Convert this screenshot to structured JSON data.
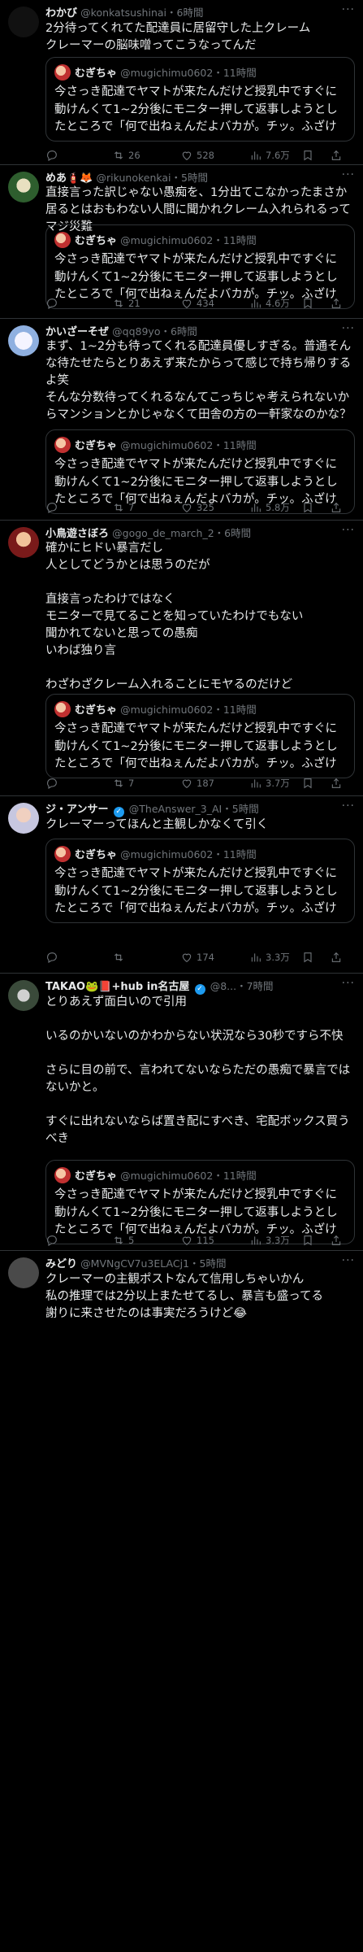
{
  "quote": {
    "name": "むぎちゃ",
    "handle": "@mugichimu0602",
    "time": "・11時間",
    "text": "今さっき配達でヤマトが来たんだけど授乳中ですぐに動けんくて1~2分後にモニター押して返事しようとしたところで「何で出ねぇんだよバカが。チッ。ふざけんなよ死ね。」って暴言吐かれてそっ閉じ。..."
  },
  "posts": [
    {
      "name": "わかび",
      "handle": "@konkatsushinai",
      "time": "・6時間",
      "text": "2分待ってくれてた配達員に居留守した上クレーム\nクレーマーの脳味噌ってこうなってんだ",
      "replies": "",
      "retweets": "26",
      "likes": "528",
      "views": "7.6万"
    },
    {
      "name": "めあ🧯🦊",
      "handle": "@rikunokenkai",
      "time": "・5時間",
      "text": "直接言った訳じゃない愚痴を、1分出てこなかったまさか居るとはおもわない人間に聞かれクレーム入れられるってマジ災難",
      "replies": "",
      "retweets": "21",
      "likes": "434",
      "views": "4.6万"
    },
    {
      "name": "かいざーそぜ",
      "handle": "@qq89yo",
      "time": "・6時間",
      "text": "まず、1~2分も待ってくれる配達員優しすぎる。普通そんな待たせたらとりあえず来たからって感じで持ち帰りするよ笑\nそんな分数待ってくれるなんてこっちじゃ考えられないからマンションとかじゃなくて田舎の方の一軒家なのかな？",
      "replies": "",
      "retweets": "7",
      "likes": "325",
      "views": "5.8万"
    },
    {
      "name": "小鳥遊さぼろ",
      "handle": "@gogo_de_march_2",
      "time": "・6時間",
      "text": "確かにヒドい暴言だし\n人としてどうかとは思うのだが\n\n直接言ったわけではなく\nモニターで見てることを知っていたわけでもない\n聞かれてないと思っての愚痴\nいわば独り言\n\nわざわざクレーム入れることにモヤるのだけど",
      "replies": "",
      "retweets": "7",
      "likes": "187",
      "views": "3.7万"
    },
    {
      "name": "ジ・アンサー",
      "handle": "@TheAnswer_3_AI",
      "time": "・5時間",
      "text": "クレーマーってほんと主観しかなくて引く",
      "replies": "",
      "retweets": "",
      "likes": "174",
      "views": "3.3万"
    },
    {
      "name": "TAKAO🐸📕+hub in名古屋",
      "handle": "@8...",
      "time": "・7時間",
      "text": "とりあえず面白いので引用\n\nいるのかいないのかわからない状況なら30秒ですら不快\n\nさらに目の前で、言われてないならただの愚痴で暴言ではないかと。\n\nすぐに出れないならば置き配にすべき、宅配ボックス買うべき",
      "replies": "",
      "retweets": "5",
      "likes": "115",
      "views": "3.3万"
    },
    {
      "name": "みどり",
      "handle": "@MVNgCV7u3ELACj1",
      "time": "・5時間",
      "text": "クレーマーの主観ポストなんて信用しちゃいかん\n私の推理では2分以上またせてるし、暴言も盛ってる\n謝りに来させたのは事実だろうけど😂",
      "replies": "",
      "retweets": "",
      "likes": "",
      "views": ""
    }
  ]
}
